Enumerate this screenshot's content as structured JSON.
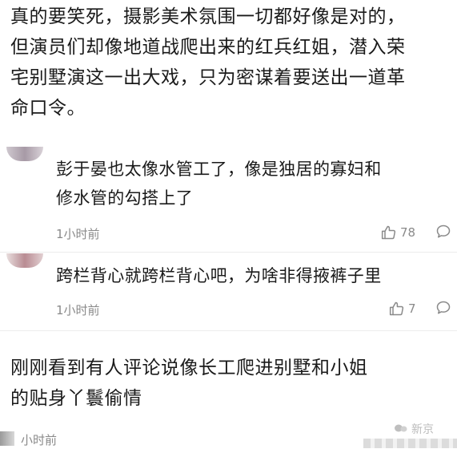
{
  "post": {
    "text": "真的要笑死，摄影美术氛围一切都好像是对的，\n但演员们却像地道战爬出来的红兵红姐，潜入荣\n宅别墅演这一出大戏，只为密谋着要送出一道革\n命口令。"
  },
  "comments": [
    {
      "text": "彭于晏也太像水管工了，像是独居的寡妇和\n修水管的勾搭上了",
      "time": "1小时前",
      "likes": "78"
    },
    {
      "text": "跨栏背心就跨栏背心吧，为啥非得掖裤子里",
      "time": "1小时前",
      "likes": "7"
    }
  ],
  "bottom_post": {
    "text": "刚刚看到有人评论说像长工爬进别墅和小姐\n的贴身丫鬟偷情",
    "time": "小时前"
  },
  "watermark": {
    "text": "新京"
  },
  "colors": {
    "text": "#1a1a1a",
    "meta": "#8a8a8a",
    "divider": "#ececec"
  }
}
